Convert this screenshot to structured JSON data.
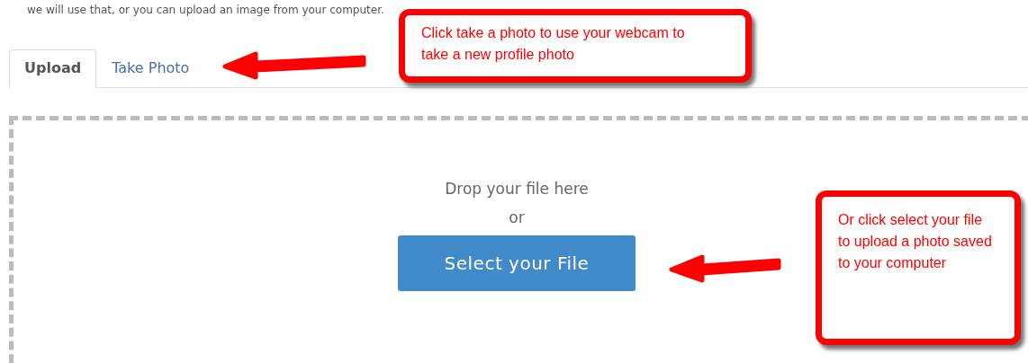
{
  "intro_text": "we will use that, or you can upload an image from your computer.",
  "tabs": [
    {
      "label": "Upload",
      "selected": true
    },
    {
      "label": "Take Photo",
      "selected": false
    }
  ],
  "dropzone": {
    "prompt": "Drop your file here",
    "separator": "or",
    "button": "Select your File"
  },
  "callouts": [
    {
      "text": "Click take a photo to use your webcam to take a new profile photo"
    },
    {
      "text": "Or click select your file to upload a photo saved to your computer"
    }
  ]
}
